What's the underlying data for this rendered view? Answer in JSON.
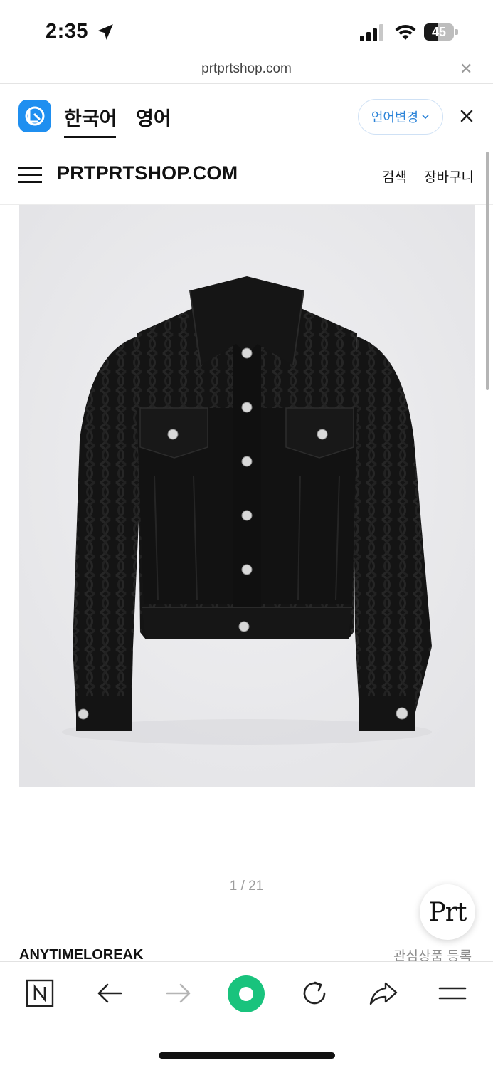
{
  "status_bar": {
    "time": "2:35",
    "battery_percent": "45",
    "battery_level": 0.45,
    "icons": [
      "location-arrow-icon",
      "signal-icon",
      "wifi-icon",
      "battery-icon"
    ]
  },
  "url_bar": {
    "url": "prtprtshop.com",
    "close_icon": "close-icon"
  },
  "translate_bar": {
    "logo_icon": "papago-logo-icon",
    "tabs": [
      {
        "label": "한국어",
        "active": true
      },
      {
        "label": "영어",
        "active": false
      }
    ],
    "change_language_label": "언어변경",
    "accent_color": "#2b83d8"
  },
  "site_header": {
    "logo": "PRTPRTSHOP.COM",
    "search_label": "검색",
    "cart_label": "장바구니"
  },
  "product": {
    "image_icon": "black-denim-jacket-image",
    "pager": "1 / 21",
    "brand": "ANYTIMELOREAK",
    "wishlist_label": "관심상품 등록",
    "badge_text": "Prt"
  },
  "bottom_toolbar": {
    "icons": [
      "naver-home-icon",
      "back-icon",
      "forward-icon",
      "green-dot-icon",
      "reload-icon",
      "share-icon",
      "menu-icon"
    ],
    "accent_color": "#19c37d"
  }
}
